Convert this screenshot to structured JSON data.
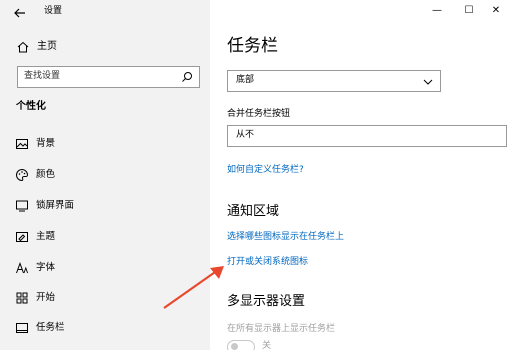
{
  "window": {
    "title": "设置",
    "minimize_glyph": "—",
    "maximize_glyph": "☐",
    "close_glyph": "✕"
  },
  "sidebar": {
    "home_label": "主页",
    "search_placeholder": "查找设置",
    "section_title": "个性化",
    "items": [
      {
        "label": "背景",
        "icon": "image-icon"
      },
      {
        "label": "颜色",
        "icon": "palette-icon"
      },
      {
        "label": "锁屏界面",
        "icon": "lock-screen-icon"
      },
      {
        "label": "主题",
        "icon": "theme-icon"
      },
      {
        "label": "字体",
        "icon": "font-icon"
      },
      {
        "label": "开始",
        "icon": "start-icon"
      },
      {
        "label": "任务栏",
        "icon": "taskbar-icon",
        "active": true
      }
    ]
  },
  "main": {
    "page_title": "任务栏",
    "position_dropdown_value": "底部",
    "combine_label": "合并任务栏按钮",
    "combine_dropdown_value": "从不",
    "customize_link": "如何自定义任务栏?",
    "notification_title": "通知区域",
    "select_icons_link": "选择哪些图标显示在任务栏上",
    "system_icons_link": "打开或关闭系统图标",
    "multi_display_title": "多显示器设置",
    "show_all_displays_label": "在所有显示器上显示任务栏",
    "toggle_state": "关"
  },
  "colors": {
    "accent": "#0067c0",
    "sidebar_bg": "#f2f2f2",
    "annotation_arrow": "#e8492e"
  }
}
